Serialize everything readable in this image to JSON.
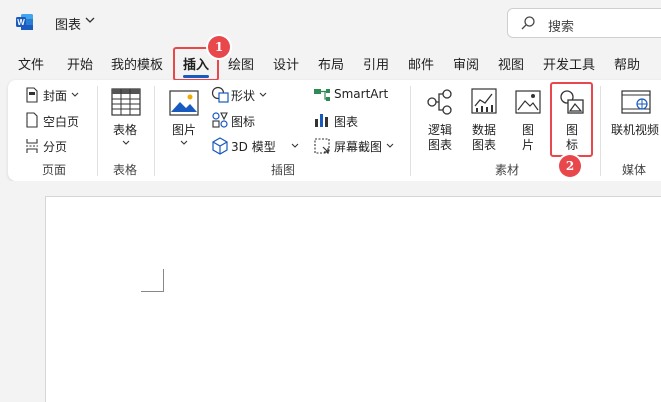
{
  "titlebar": {
    "doc_title": "图表",
    "search_placeholder": "搜索"
  },
  "tabs": [
    "文件",
    "开始",
    "我的模板",
    "插入",
    "绘图",
    "设计",
    "布局",
    "引用",
    "邮件",
    "审阅",
    "视图",
    "开发工具",
    "帮助"
  ],
  "active_tab": "插入",
  "ribbon": {
    "pages": {
      "cover": "封面",
      "blank": "空白页",
      "break": "分页",
      "label": "页面"
    },
    "table": {
      "button": "表格",
      "label": "表格"
    },
    "illustrations": {
      "pictures": "图片",
      "shapes": "形状",
      "icons": "图标",
      "models3d": "3D 模型",
      "smartart": "SmartArt",
      "chart": "图表",
      "screenshot": "屏幕截图",
      "label": "插图"
    },
    "assets": {
      "logic_line1": "逻辑",
      "logic_line2": "图表",
      "data_line1": "数据",
      "data_line2": "图表",
      "pic_line1": "图",
      "pic_line2": "片",
      "icon_line1": "图",
      "icon_line2": "标",
      "label": "素材"
    },
    "media": {
      "online_video": "联机视频",
      "label": "媒体"
    }
  },
  "annotations": {
    "step1": "1",
    "step2": "2",
    "color": "#e8474c"
  },
  "colors": {
    "accent": "#185abd",
    "word_blue": "#185abd"
  }
}
